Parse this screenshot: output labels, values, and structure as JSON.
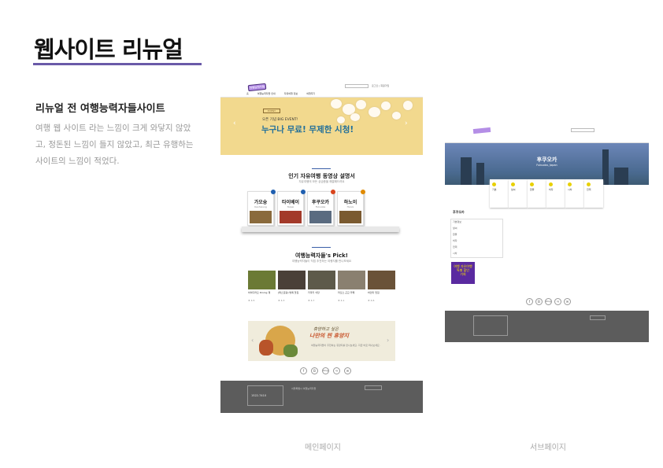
{
  "heading": "웹사이트 리뉴얼",
  "subheading": "리뉴얼 전 여행능력자들사이트",
  "description": "여행 웹 사이트 라는 느낌이 크게 와닿지 않았고, 정돈된 느낌이 들지 않았고, 최근 유행하는 사이트의 느낌이 적었다.",
  "captions": {
    "main": "메인페이지",
    "sub": "서브페이지"
  },
  "colors": {
    "accent": "#6a5aa8",
    "hero_text": "#1f6e9a",
    "footer": "#5c5c5c"
  },
  "main_page": {
    "logo": "여행능력자들",
    "nav": [
      "홈",
      "여행능력자들 안내",
      "자유여행 정보",
      "여행후기"
    ],
    "util": "로그인 | 회원가입",
    "hero": {
      "event_tag": "EVENT",
      "line1": "오픈 기념 BIG EVENT!",
      "line2": "누구나 무료! 무제한 시청!"
    },
    "section1": {
      "title": "인기 자유여행 동영상 설명서",
      "desc": "자유여행의 모든 궁금증을 해결해드려요"
    },
    "books": [
      {
        "title": "가오슝",
        "sub": "Kaohsiung"
      },
      {
        "title": "타이베이",
        "sub": "Taipei"
      },
      {
        "title": "후쿠오카",
        "sub": "Fukuoka"
      },
      {
        "title": "하노이",
        "sub": "Hanoi"
      }
    ],
    "section2": {
      "title": "여행능력자들's Pick!",
      "desc": "여행능력자들이 직접 추천하는 여행지를 만나보세요"
    },
    "picks": [
      {
        "title": "하이디라오 Dining 재",
        "sub": "★ 4.5"
      },
      {
        "title": "[레스토랑] 방콕 맛집",
        "sub": "★ 4.3"
      },
      {
        "title": "키쿠키 식당",
        "sub": "★ 4.7"
      },
      {
        "title": "라오스 근교 카페",
        "sub": "★ 4.1"
      },
      {
        "title": "바인미 맛집",
        "sub": "★ 4.6"
      }
    ],
    "banner2": {
      "line1": "휴양하고 싶은",
      "line2": "나만의 찐 휴양지",
      "line3": "여행능력자들이 추천하는 휴양지를 만나보세요. 지금 바로 떠나보세요."
    },
    "social": [
      "f",
      "B",
      "blog",
      "ig",
      "✉"
    ],
    "footer": {
      "phone": "1522-7410",
      "addr": "서울특별시 여행능력자들"
    }
  },
  "sub_page": {
    "hero_title": "후쿠오카",
    "hero_sub": "Fukuoka, Japan",
    "categories": [
      "기본",
      "날씨",
      "환율",
      "비자",
      "시차",
      "전력"
    ],
    "side_title": "후쿠오카",
    "side_items": [
      "기본정보",
      "날씨",
      "환율",
      "비자",
      "전력",
      "시차"
    ],
    "ad": [
      "여행 자유여행",
      "특별 할인",
      "기회"
    ],
    "social": [
      "f",
      "B",
      "blog",
      "ig",
      "✉"
    ]
  }
}
